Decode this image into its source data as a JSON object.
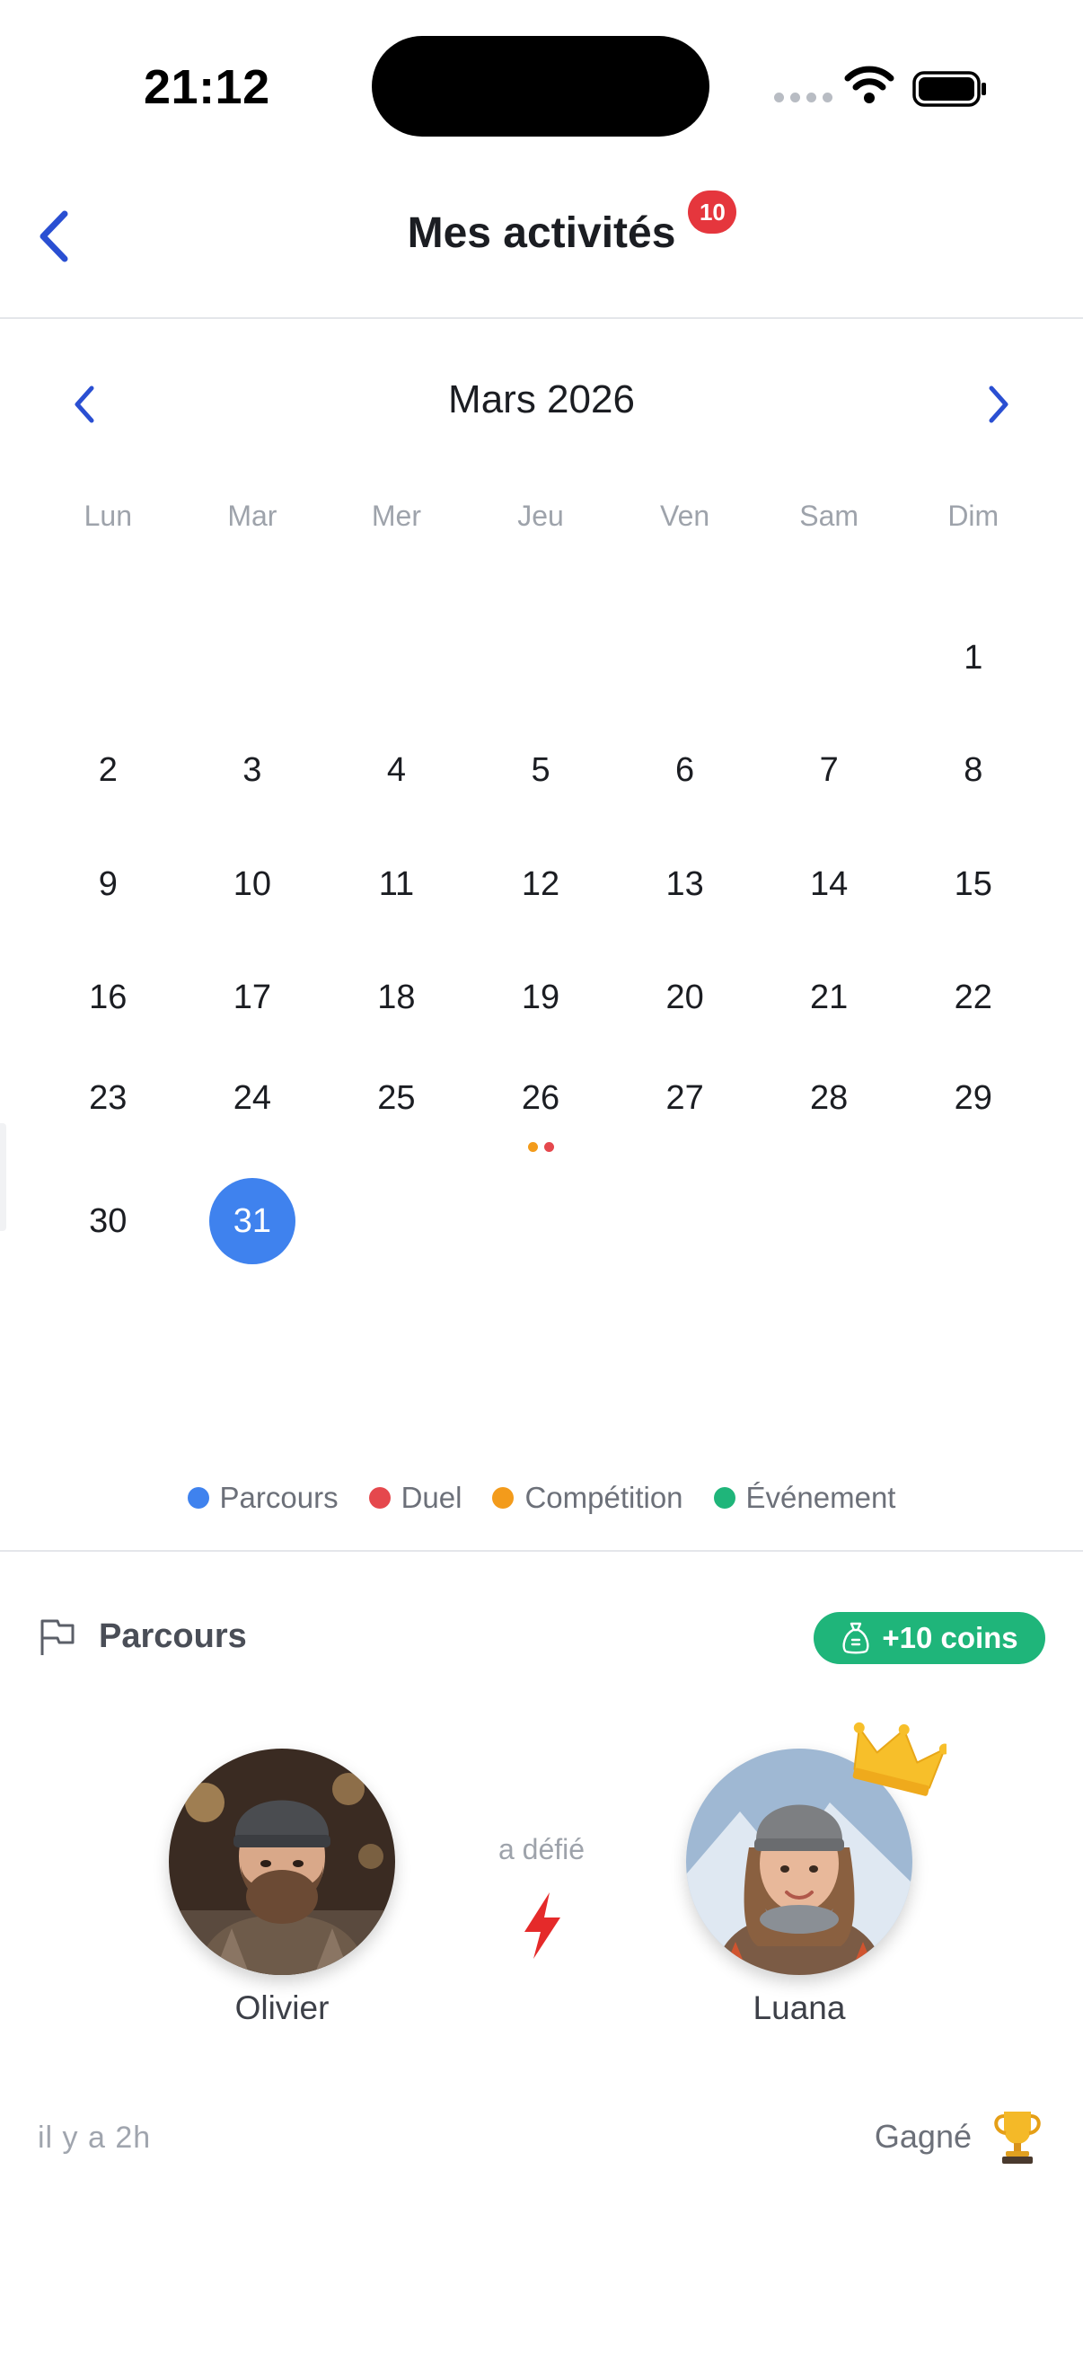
{
  "status_bar": {
    "time": "21:12",
    "icons": [
      "signal-icon",
      "wifi-icon",
      "battery-icon"
    ]
  },
  "header": {
    "title": "Mes activités",
    "badge": "10",
    "back_icon": "chevron-left-icon"
  },
  "calendar": {
    "month_label": "Mars 2026",
    "weekdays": [
      "Lun",
      "Mar",
      "Mer",
      "Jeu",
      "Ven",
      "Sam",
      "Dim"
    ],
    "weeks": [
      [
        "",
        "",
        "",
        "",
        "",
        "",
        "1"
      ],
      [
        "2",
        "3",
        "4",
        "5",
        "6",
        "7",
        "8"
      ],
      [
        "9",
        "10",
        "11",
        "12",
        "13",
        "14",
        "15"
      ],
      [
        "16",
        "17",
        "18",
        "19",
        "20",
        "21",
        "22"
      ],
      [
        "23",
        "24",
        "25",
        "26",
        "27",
        "28",
        "29"
      ],
      [
        "30",
        "31",
        "",
        "",
        "",
        "",
        ""
      ]
    ],
    "selected_day": "31",
    "event_days": {
      "26": [
        "#f39b1b",
        "#e5484d"
      ]
    }
  },
  "legend": [
    {
      "label": "Parcours",
      "color": "#3f82ee"
    },
    {
      "label": "Duel",
      "color": "#e5484d"
    },
    {
      "label": "Compétition",
      "color": "#f39b1b"
    },
    {
      "label": "Événement",
      "color": "#1fb57a"
    }
  ],
  "activity": {
    "type_label": "Parcours",
    "type_icon": "flag-icon",
    "reward": "+10 coins",
    "reward_icon": "coin-bag-icon",
    "challenger": "Olivier",
    "verb": "a défié",
    "opponent": "Luana",
    "time_ago": "il y a 2h",
    "result": "Gagné",
    "result_icon": "trophy-icon",
    "winner_icon": "crown-icon"
  },
  "colors": {
    "accent": "#3f82ee",
    "nav_blue": "#2a4fd2",
    "badge_red": "#e5363d",
    "green": "#1fb57a"
  }
}
